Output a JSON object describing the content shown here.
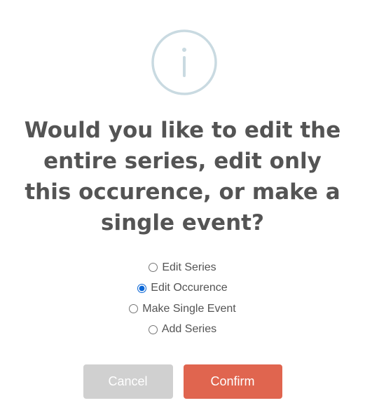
{
  "dialog": {
    "icon": "info-icon",
    "title": "Would you like to edit the entire series, edit only this occurence, or make a single event?",
    "options": [
      {
        "label": "Edit Series",
        "checked": false
      },
      {
        "label": "Edit Occurence",
        "checked": true
      },
      {
        "label": "Make Single Event",
        "checked": false
      },
      {
        "label": "Add Series",
        "checked": false
      }
    ],
    "cancel_label": "Cancel",
    "confirm_label": "Confirm"
  },
  "colors": {
    "icon_ring": "#c9dae1",
    "title_text": "#545454",
    "radio_selected": "#0a66d6",
    "cancel_bg": "#d0d0d0",
    "confirm_bg": "#e0654f"
  }
}
